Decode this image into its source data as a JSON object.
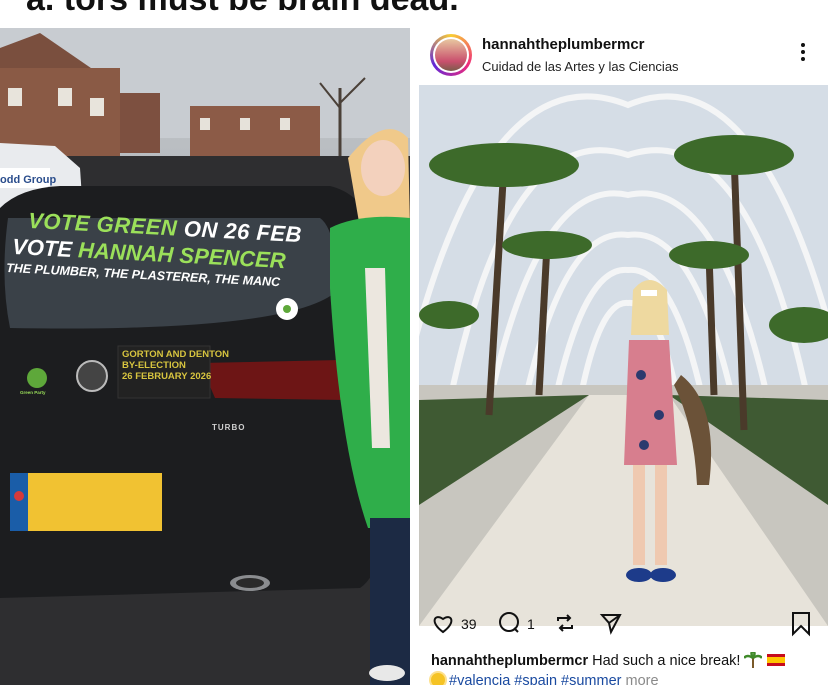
{
  "headline": "a. tors must be brain dead.",
  "left_photo": {
    "van_text": "odd Group",
    "rear_window": {
      "line1_green": "VOTE GREEN",
      "line1_white": "ON 26 FEB",
      "line2_white": "VOTE",
      "line2_green": "HANNAH SPENCER",
      "line3": "THE PLUMBER, THE PLASTERER, THE MANC"
    },
    "party_logo_label": "Green Party",
    "election_sticker": [
      "GORTON AND DENTON",
      "BY-ELECTION",
      "26 FEBRUARY 2026"
    ],
    "badge": "TURBO"
  },
  "post": {
    "username": "hannahtheplumbermcr",
    "location": "Cuidad de las Artes y las Ciencias",
    "likes": "39",
    "comments": "1",
    "caption_user": "hannahtheplumbermcr",
    "caption_text": "Had such a nice break!",
    "hashtags": "#valencia #spain #summer",
    "more_label": "more",
    "icons": {
      "like": "heart-icon",
      "comment": "comment-icon",
      "repost": "repost-icon",
      "share": "send-icon",
      "save": "bookmark-icon",
      "options": "more-options-icon"
    },
    "colors": {
      "link": "#1a4aa0",
      "muted": "#8a8a8a"
    }
  }
}
